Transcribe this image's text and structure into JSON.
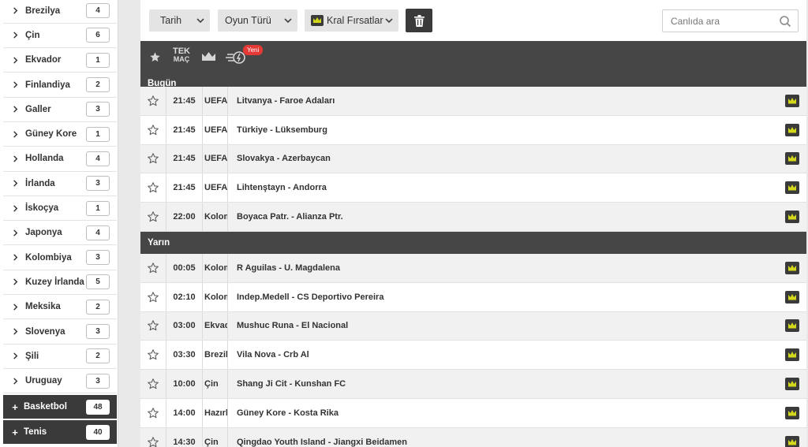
{
  "sidebar": {
    "items": [
      {
        "label": "Brezilya",
        "count": "4"
      },
      {
        "label": "Çin",
        "count": "6"
      },
      {
        "label": "Ekvador",
        "count": "1"
      },
      {
        "label": "Finlandiya",
        "count": "2"
      },
      {
        "label": "Galler",
        "count": "3"
      },
      {
        "label": "Güney Kore",
        "count": "1"
      },
      {
        "label": "Hollanda",
        "count": "4"
      },
      {
        "label": "İrlanda",
        "count": "3"
      },
      {
        "label": "İskoçya",
        "count": "1"
      },
      {
        "label": "Japonya",
        "count": "4"
      },
      {
        "label": "Kolombiya",
        "count": "3"
      },
      {
        "label": "Kuzey İrlanda",
        "count": "5"
      },
      {
        "label": "Meksika",
        "count": "2"
      },
      {
        "label": "Slovenya",
        "count": "3"
      },
      {
        "label": "Şili",
        "count": "2"
      },
      {
        "label": "Uruguay",
        "count": "3"
      }
    ],
    "categories": [
      {
        "label": "Basketbol",
        "count": "48",
        "icon": "plus-icon"
      },
      {
        "label": "Tenis",
        "count": "40",
        "icon": "plus-icon"
      }
    ]
  },
  "toolbar": {
    "date_label": "Tarih",
    "game_type_label": "Oyun Türü",
    "kral_label": "Kral Fırsatlar",
    "search_placeholder": "Canlıda ara"
  },
  "filterbar": {
    "tek_line1": "TEK",
    "tek_line2": "MAÇ",
    "new_badge": "Yeni"
  },
  "sections": {
    "today": {
      "title": "Bugün",
      "matches": [
        {
          "time": "21:45",
          "league": "UEFA",
          "teams": "Litvanya - Faroe Adaları"
        },
        {
          "time": "21:45",
          "league": "UEFA",
          "teams": "Türkiye - Lüksemburg"
        },
        {
          "time": "21:45",
          "league": "UEFA",
          "teams": "Slovakya - Azerbaycan"
        },
        {
          "time": "21:45",
          "league": "UEFA",
          "teams": "Lihtenştayn - Andorra"
        },
        {
          "time": "22:00",
          "league": "Kolombiya",
          "teams": "Boyaca Patr. - Alianza Ptr."
        }
      ]
    },
    "tomorrow": {
      "title": "Yarın",
      "matches": [
        {
          "time": "00:05",
          "league": "Kolombiya",
          "teams": "R Aguilas - U. Magdalena"
        },
        {
          "time": "02:10",
          "league": "Kolombiya",
          "teams": "Indep.Medell - CS Deportivo Pereira"
        },
        {
          "time": "03:00",
          "league": "Ekvador",
          "teams": "Mushuc Runa - El Nacional"
        },
        {
          "time": "03:30",
          "league": "Brezilya",
          "teams": "Vila Nova - Crb Al"
        },
        {
          "time": "10:00",
          "league": "Çin",
          "teams": "Shang Ji Cit - Kunshan FC"
        },
        {
          "time": "14:00",
          "league": "Hazırlık",
          "teams": "Güney Kore - Kosta Rika"
        },
        {
          "time": "14:30",
          "league": "Çin",
          "teams": "Qingdao Youth Island - Jiangxi Beidamen"
        }
      ]
    }
  },
  "colors": {
    "dark_bar": "#464646",
    "crown_yellow": "#d4d81b",
    "badge_red": "#e53935"
  }
}
